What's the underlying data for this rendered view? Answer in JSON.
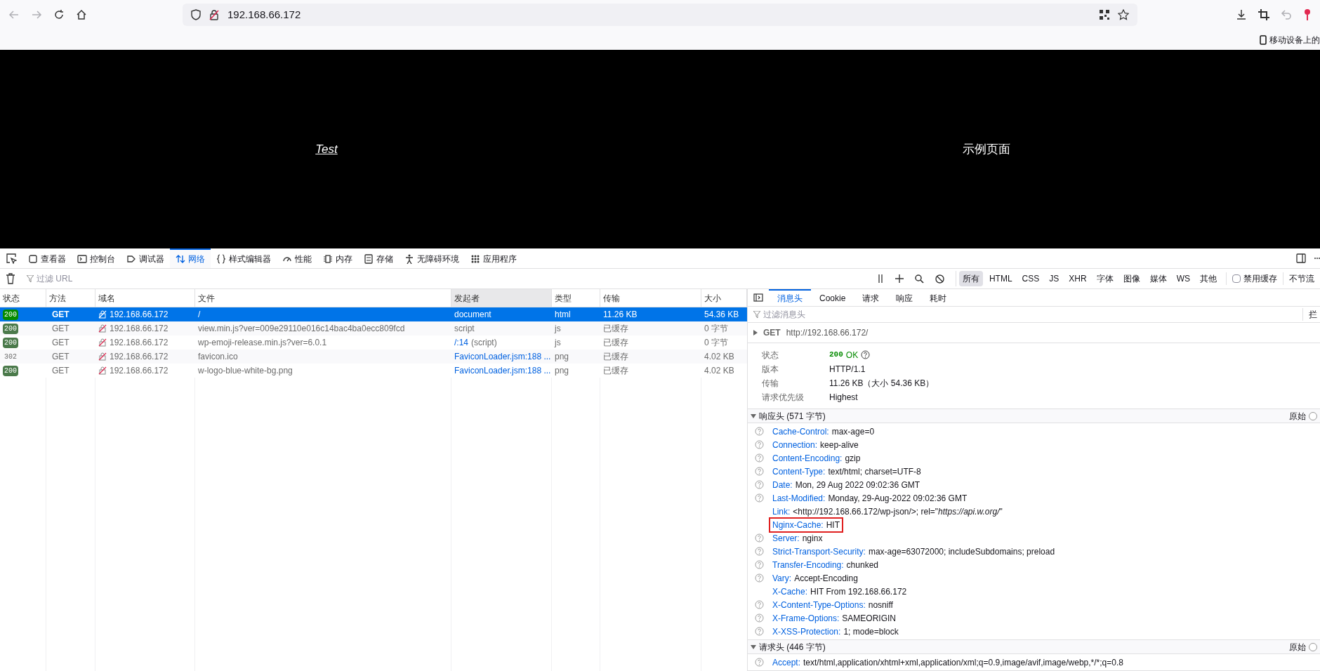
{
  "browser": {
    "url": "192.168.66.172",
    "bookmark_hint": "移动设备上的"
  },
  "page": {
    "link": "Test",
    "title": "示例页面"
  },
  "devtools": {
    "tabs": [
      {
        "label": "查看器",
        "selected": false
      },
      {
        "label": "控制台",
        "selected": false
      },
      {
        "label": "调试器",
        "selected": false
      },
      {
        "label": "网络",
        "selected": true
      },
      {
        "label": "样式编辑器",
        "selected": false
      },
      {
        "label": "性能",
        "selected": false
      },
      {
        "label": "内存",
        "selected": false
      },
      {
        "label": "存储",
        "selected": false
      },
      {
        "label": "无障碍环境",
        "selected": false
      },
      {
        "label": "应用程序",
        "selected": false
      }
    ]
  },
  "network": {
    "filter_placeholder": "过滤 URL",
    "type_filters": [
      {
        "label": "所有",
        "selected": true
      },
      {
        "label": "HTML",
        "selected": false
      },
      {
        "label": "CSS",
        "selected": false
      },
      {
        "label": "JS",
        "selected": false
      },
      {
        "label": "XHR",
        "selected": false
      },
      {
        "label": "字体",
        "selected": false
      },
      {
        "label": "图像",
        "selected": false
      },
      {
        "label": "媒体",
        "selected": false
      },
      {
        "label": "WS",
        "selected": false
      },
      {
        "label": "其他",
        "selected": false
      }
    ],
    "disable_cache": {
      "label": "禁用缓存",
      "checked": false
    },
    "throttling": "不节流",
    "columns": [
      "状态",
      "方法",
      "域名",
      "文件",
      "发起者",
      "类型",
      "传输",
      "大小"
    ],
    "rows": [
      {
        "selected": true,
        "status": "200",
        "status_badge": true,
        "method": "GET",
        "domain": "192.168.66.172",
        "file": "/",
        "initiator": "document",
        "initiator_link": false,
        "type": "html",
        "transfer": "11.26 KB",
        "size": "54.36 KB"
      },
      {
        "selected": false,
        "status": "200",
        "status_badge": true,
        "method": "GET",
        "domain": "192.168.66.172",
        "file": "view.min.js?ver=009e29110e016c14bac4ba0ecc809fcd",
        "initiator": "script",
        "initiator_link": false,
        "type": "js",
        "transfer": "已缓存",
        "size": "0 字节"
      },
      {
        "selected": false,
        "status": "200",
        "status_badge": true,
        "method": "GET",
        "domain": "192.168.66.172",
        "file": "wp-emoji-release.min.js?ver=6.0.1",
        "initiator": "/:14",
        "initiator_note": "(script)",
        "initiator_link": true,
        "type": "js",
        "transfer": "已缓存",
        "size": "0 字节"
      },
      {
        "selected": false,
        "status": "302",
        "status_badge": false,
        "method": "GET",
        "domain": "192.168.66.172",
        "file": "favicon.ico",
        "initiator": "FaviconLoader.jsm:188 ...",
        "initiator_link": true,
        "type": "png",
        "transfer": "已缓存",
        "size": "4.02 KB"
      },
      {
        "selected": false,
        "status": "200",
        "status_badge": true,
        "method": "GET",
        "domain": "192.168.66.172",
        "file": "w-logo-blue-white-bg.png",
        "initiator": "FaviconLoader.jsm:188 ...",
        "initiator_link": true,
        "type": "png",
        "transfer": "已缓存",
        "size": "4.02 KB"
      }
    ]
  },
  "details": {
    "tabs": [
      {
        "label": "消息头",
        "selected": true
      },
      {
        "label": "Cookie",
        "selected": false
      },
      {
        "label": "请求",
        "selected": false
      },
      {
        "label": "响应",
        "selected": false
      },
      {
        "label": "耗时",
        "selected": false
      }
    ],
    "filter_placeholder": "过滤消息头",
    "block_label": "拦",
    "request_line": {
      "method": "GET",
      "url": "http://192.168.66.172/"
    },
    "summary": [
      {
        "label": "状态",
        "kind": "status",
        "code": "200",
        "value": "OK"
      },
      {
        "label": "版本",
        "kind": "text",
        "value": "HTTP/1.1"
      },
      {
        "label": "传输",
        "kind": "text",
        "value": "11.26 KB（大小 54.36 KB）"
      },
      {
        "label": "请求优先级",
        "kind": "text",
        "value": "Highest"
      }
    ],
    "response_headers": {
      "title": "响应头 (571 字节)",
      "expanded": true,
      "raw_label": "原始",
      "raw": false,
      "headers": [
        {
          "name": "Cache-Control:",
          "value": "max-age=0",
          "help": true,
          "highlighted": false
        },
        {
          "name": "Connection:",
          "value": "keep-alive",
          "help": true,
          "highlighted": false
        },
        {
          "name": "Content-Encoding:",
          "value": "gzip",
          "help": true,
          "highlighted": false
        },
        {
          "name": "Content-Type:",
          "value": "text/html; charset=UTF-8",
          "help": true,
          "highlighted": false
        },
        {
          "name": "Date:",
          "value": "Mon, 29 Aug 2022 09:02:36 GMT",
          "help": true,
          "highlighted": false
        },
        {
          "name": "Last-Modified:",
          "value": "Monday, 29-Aug-2022 09:02:36 GMT",
          "help": true,
          "highlighted": false
        },
        {
          "name": "Link:",
          "value": "<http://192.168.66.172/wp-json/>; rel=\"",
          "value_italic": "https://api.w.org/",
          "value_after": "\"",
          "help": false,
          "highlighted": false
        },
        {
          "name": "Nginx-Cache:",
          "value": "HIT",
          "help": false,
          "highlighted": true
        },
        {
          "name": "Server:",
          "value": "nginx",
          "help": true,
          "highlighted": false
        },
        {
          "name": "Strict-Transport-Security:",
          "value": "max-age=63072000; includeSubdomains; preload",
          "help": true,
          "highlighted": false
        },
        {
          "name": "Transfer-Encoding:",
          "value": "chunked",
          "help": true,
          "highlighted": false
        },
        {
          "name": "Vary:",
          "value": "Accept-Encoding",
          "help": true,
          "highlighted": false
        },
        {
          "name": "X-Cache:",
          "value": "HIT From 192.168.66.172",
          "help": false,
          "highlighted": false
        },
        {
          "name": "X-Content-Type-Options:",
          "value": "nosniff",
          "help": true,
          "highlighted": false
        },
        {
          "name": "X-Frame-Options:",
          "value": "SAMEORIGIN",
          "help": true,
          "highlighted": false
        },
        {
          "name": "X-XSS-Protection:",
          "value": "1; mode=block",
          "help": true,
          "highlighted": false
        }
      ]
    },
    "request_headers": {
      "title": "请求头 (446 字节)",
      "expanded": true,
      "raw_label": "原始",
      "raw": false,
      "headers": [
        {
          "name": "Accept:",
          "value": "text/html,application/xhtml+xml,application/xml;q=0.9,image/avif,image/webp,*/*;q=0.8",
          "help": true,
          "highlighted": false
        }
      ]
    }
  }
}
